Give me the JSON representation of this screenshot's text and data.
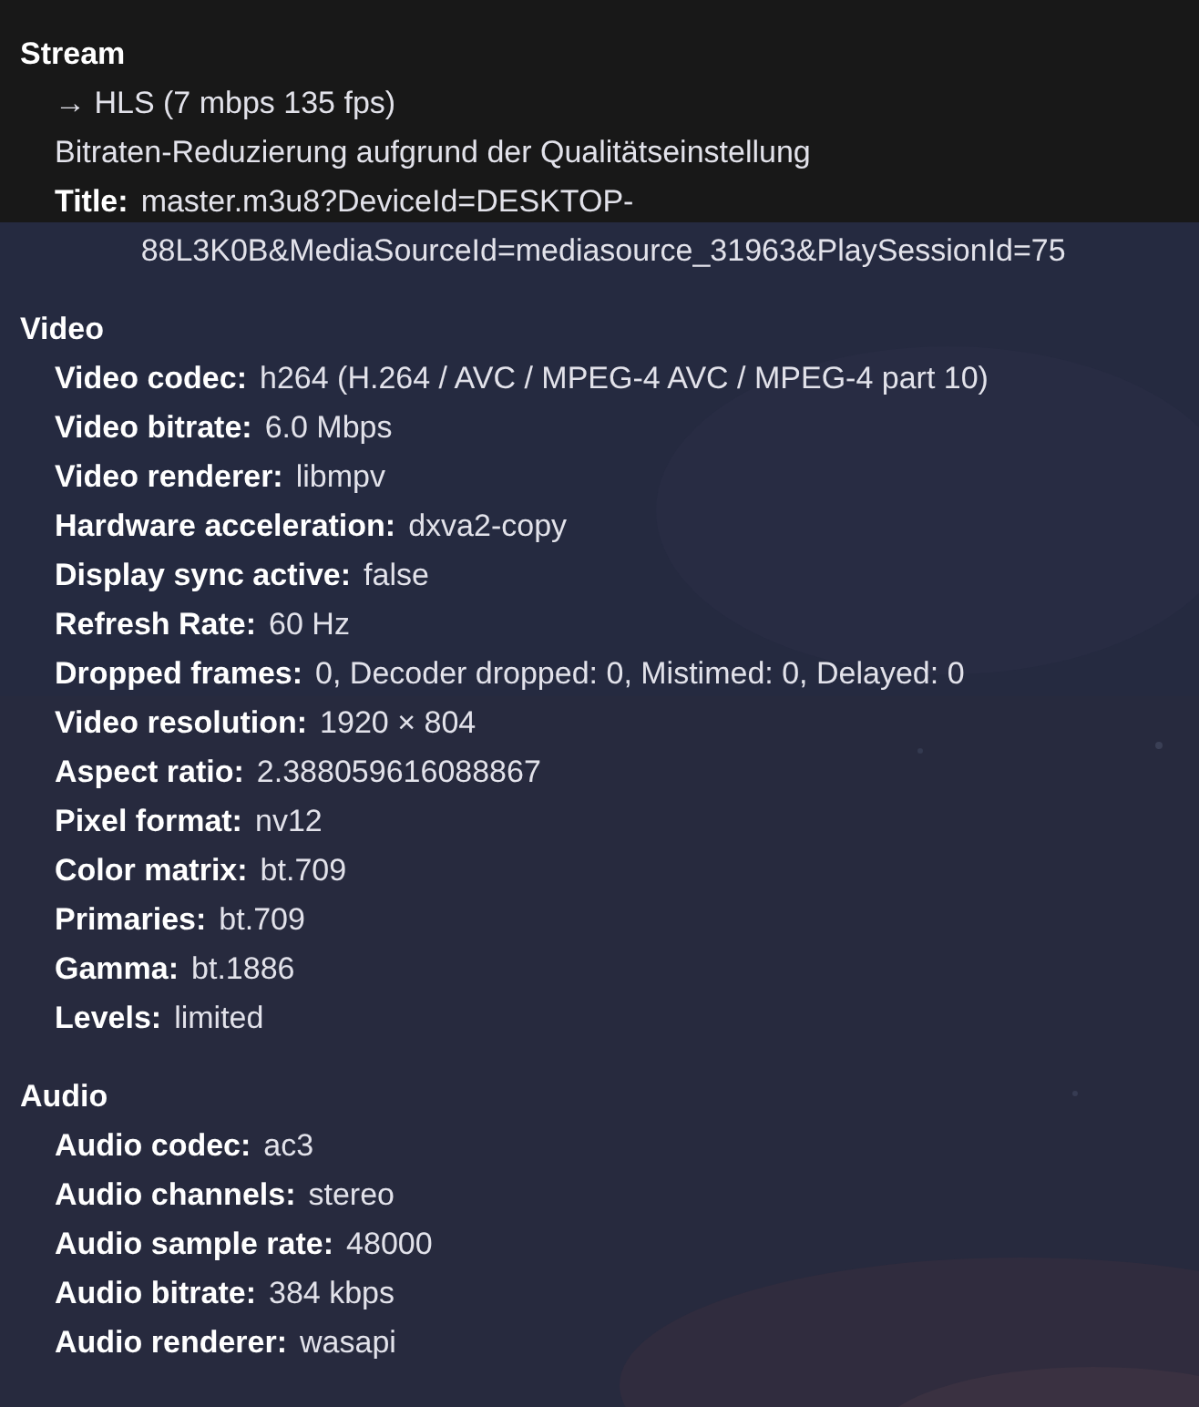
{
  "sections": [
    {
      "title": "Stream",
      "items": [
        {
          "kind": "text",
          "text": "→ HLS (7 mbps 135 fps)"
        },
        {
          "kind": "text",
          "text": "Bitraten-Reduzierung aufgrund der Qualitätseinstellung"
        },
        {
          "kind": "field",
          "label": "Title:",
          "value": "master.m3u8?DeviceId=DESKTOP-88L3K0B&MediaSourceId=mediasource_31963&PlaySessionId=75"
        }
      ]
    },
    {
      "title": "Video",
      "items": [
        {
          "kind": "field",
          "label": "Video codec:",
          "value": "h264 (H.264 / AVC / MPEG-4 AVC / MPEG-4 part 10)"
        },
        {
          "kind": "field",
          "label": "Video bitrate:",
          "value": "6.0 Mbps"
        },
        {
          "kind": "field",
          "label": "Video renderer:",
          "value": "libmpv"
        },
        {
          "kind": "field",
          "label": "Hardware acceleration:",
          "value": "dxva2-copy"
        },
        {
          "kind": "field",
          "label": "Display sync active:",
          "value": "false"
        },
        {
          "kind": "field",
          "label": "Refresh Rate:",
          "value": "60 Hz"
        },
        {
          "kind": "field",
          "label": "Dropped frames:",
          "value": "0, Decoder dropped: 0, Mistimed: 0, Delayed: 0"
        },
        {
          "kind": "field",
          "label": "Video resolution:",
          "value": "1920 × 804"
        },
        {
          "kind": "field",
          "label": "Aspect ratio:",
          "value": "2.388059616088867"
        },
        {
          "kind": "field",
          "label": "Pixel format:",
          "value": "nv12"
        },
        {
          "kind": "field",
          "label": "Color matrix:",
          "value": "bt.709"
        },
        {
          "kind": "field",
          "label": "Primaries:",
          "value": "bt.709"
        },
        {
          "kind": "field",
          "label": "Gamma:",
          "value": "bt.1886"
        },
        {
          "kind": "field",
          "label": "Levels:",
          "value": "limited"
        }
      ]
    },
    {
      "title": "Audio",
      "items": [
        {
          "kind": "field",
          "label": "Audio codec:",
          "value": "ac3"
        },
        {
          "kind": "field",
          "label": "Audio channels:",
          "value": "stereo"
        },
        {
          "kind": "field",
          "label": "Audio sample rate:",
          "value": "48000"
        },
        {
          "kind": "field",
          "label": "Audio bitrate:",
          "value": "384 kbps"
        },
        {
          "kind": "field",
          "label": "Audio renderer:",
          "value": "wasapi"
        }
      ]
    }
  ]
}
